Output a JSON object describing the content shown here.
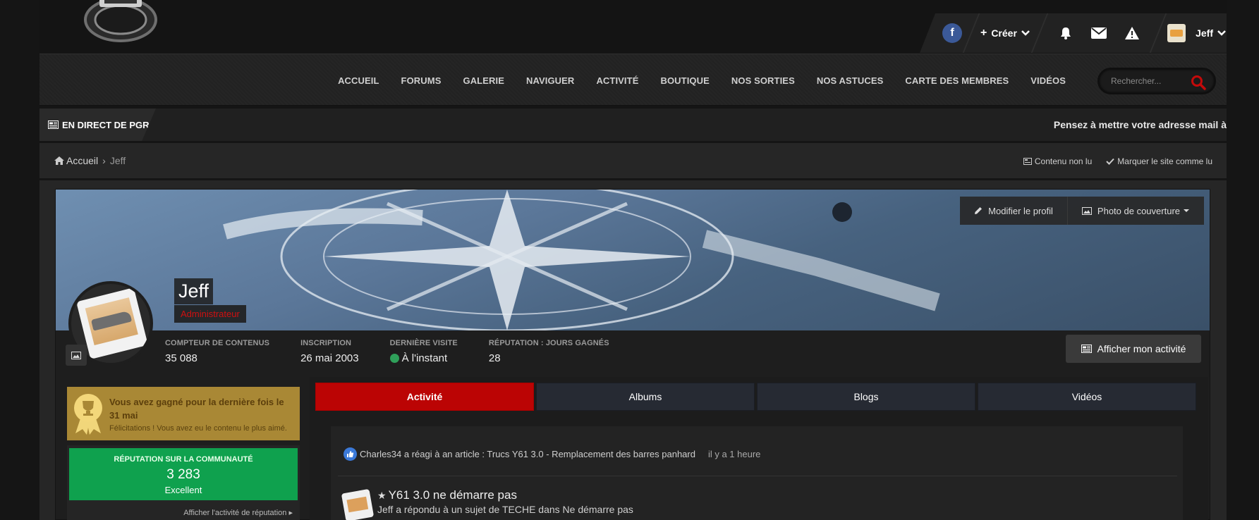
{
  "header": {
    "create_label": "Créer",
    "user_name": "Jeff"
  },
  "nav": {
    "items": [
      "ACCUEIL",
      "FORUMS",
      "GALERIE",
      "NAVIGUER",
      "ACTIVITÉ",
      "BOUTIQUE",
      "NOS SORTIES",
      "NOS ASTUCES",
      "CARTE DES MEMBRES",
      "VIDÉOS"
    ],
    "search_placeholder": "Rechercher..."
  },
  "ticker": {
    "label": "EN DIRECT DE PGR",
    "text": "Pensez à mettre votre adresse mail à"
  },
  "breadcrumb": {
    "home": "Accueil",
    "current": "Jeff",
    "unread": "Contenu non lu",
    "mark_read": "Marquer le site comme lu"
  },
  "profile": {
    "name": "Jeff",
    "role": "Administrateur",
    "edit_profile": "Modifier le profil",
    "cover_photo": "Photo de couverture",
    "stats": [
      {
        "label": "COMPTEUR DE CONTENUS",
        "value": "35 088"
      },
      {
        "label": "INSCRIPTION",
        "value": "26 mai 2003"
      },
      {
        "label": "DERNIÈRE VISITE",
        "value": "À l'instant"
      },
      {
        "label": "RÉPUTATION : JOURS GAGNÉS",
        "value": "28"
      }
    ],
    "activity_button": "Afficher mon activité"
  },
  "award": {
    "title": "Vous avez gagné pour la dernière fois le 31 mai",
    "subtitle": "Félicitations ! Vous avez eu le contenu le plus aimé."
  },
  "reputation": {
    "title": "RÉPUTATION SUR LA COMMUNAUTÉ",
    "value": "3 283",
    "level": "Excellent",
    "link": "Afficher l'activité de réputation"
  },
  "tabs": [
    "Activité",
    "Albums",
    "Blogs",
    "Vidéos"
  ],
  "stream": {
    "item1_text": "Charles34 a réagi à an article : Trucs Y61 3.0 - Remplacement des barres panhard",
    "item1_time": "il y a 1 heure",
    "item2_title": "Y61 3.0 ne démarre pas",
    "item2_sub": "Jeff a répondu à un sujet de TECHE dans Ne démarre pas"
  },
  "colors": {
    "accent_red": "#bb0404",
    "reputation_green": "#0fa14e",
    "award_gold": "#a98835",
    "facebook_blue": "#3b5998"
  }
}
